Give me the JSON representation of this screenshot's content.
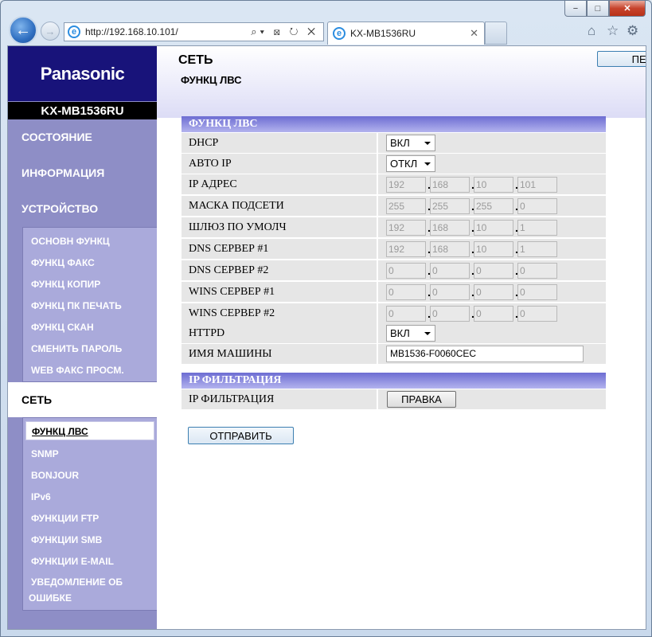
{
  "browser": {
    "url": "http://192.168.10.101/",
    "tab_title": "KX-MB1536RU",
    "ie_glyph": "e",
    "window_controls": {
      "min": "−",
      "max": "□",
      "close": "✕"
    },
    "nav": {
      "back": "←",
      "forward": "→"
    },
    "addr_tools": "⌕▾ ⊠ ↻ ✕",
    "tab_close": "✕",
    "right_icons": {
      "home": "⌂",
      "favorites": "☆",
      "settings": "⚙"
    }
  },
  "sidebar": {
    "logo": "Panasonic",
    "model": "KX-MB1536RU",
    "main_items": [
      "СОСТОЯНИЕ",
      "ИНФОРМАЦИЯ",
      "УСТРОЙСТВО"
    ],
    "device_items": [
      "ОСНОВН ФУНКЦ",
      "ФУНКЦ ФАКС",
      "ФУНКЦ КОПИР",
      "ФУНКЦ ПК ПЕЧАТЬ",
      "ФУНКЦ СКАН",
      "СМЕНИТЬ ПАРОЛЬ",
      "WEB ФАКС ПРОСМ."
    ],
    "network_item": "СЕТЬ",
    "network_items": [
      "ФУНКЦ ЛВС",
      "SNMP",
      "BONJOUR",
      "IPv6",
      "ФУНКЦИИ FTP",
      "ФУНКЦИИ SMB",
      "ФУНКЦИИ E-MAIL",
      "УВЕДОМЛЕНИЕ ОБ",
      "ОШИБКЕ"
    ]
  },
  "header": {
    "title": "СЕТЬ",
    "subtitle": "ФУНКЦ ЛВС",
    "reboot_label": "ПЕРЕЗАГРУЗИТЬ"
  },
  "lan": {
    "section_title": "ФУНКЦ ЛВС",
    "dhcp": {
      "label": "DHCP",
      "value": "ВКЛ"
    },
    "auto_ip": {
      "label": "АВТО IP",
      "value": "ОТКЛ"
    },
    "ip_address": {
      "label": "IP АДРЕС",
      "octets": [
        "192",
        "168",
        "10",
        "101"
      ]
    },
    "subnet_mask": {
      "label": "МАСКА ПОДСЕТИ",
      "octets": [
        "255",
        "255",
        "255",
        "0"
      ]
    },
    "gateway": {
      "label": "ШЛЮЗ ПО УМОЛЧ",
      "octets": [
        "192",
        "168",
        "10",
        "1"
      ]
    },
    "dns1": {
      "label": "DNS СЕРВЕР #1",
      "octets": [
        "192",
        "168",
        "10",
        "1"
      ]
    },
    "dns2": {
      "label": "DNS СЕРВЕР #2",
      "octets": [
        "0",
        "0",
        "0",
        "0"
      ]
    },
    "wins1": {
      "label": "WINS СЕРВЕР #1",
      "octets": [
        "0",
        "0",
        "0",
        "0"
      ]
    },
    "wins2": {
      "label": "WINS СЕРВЕР #2",
      "octets": [
        "0",
        "0",
        "0",
        "0"
      ]
    },
    "httpd": {
      "label": "HTTPD",
      "value": "ВКЛ"
    },
    "host_name": {
      "label": "ИМЯ МАШИНЫ",
      "value": "MB1536-F0060CEC"
    }
  },
  "ipfilter": {
    "section_title": "IP ФИЛЬТРАЦИЯ",
    "row_label": "IP ФИЛЬТРАЦИЯ",
    "edit_label": "ПРАВКА"
  },
  "submit_label": "ОТПРАВИТЬ"
}
